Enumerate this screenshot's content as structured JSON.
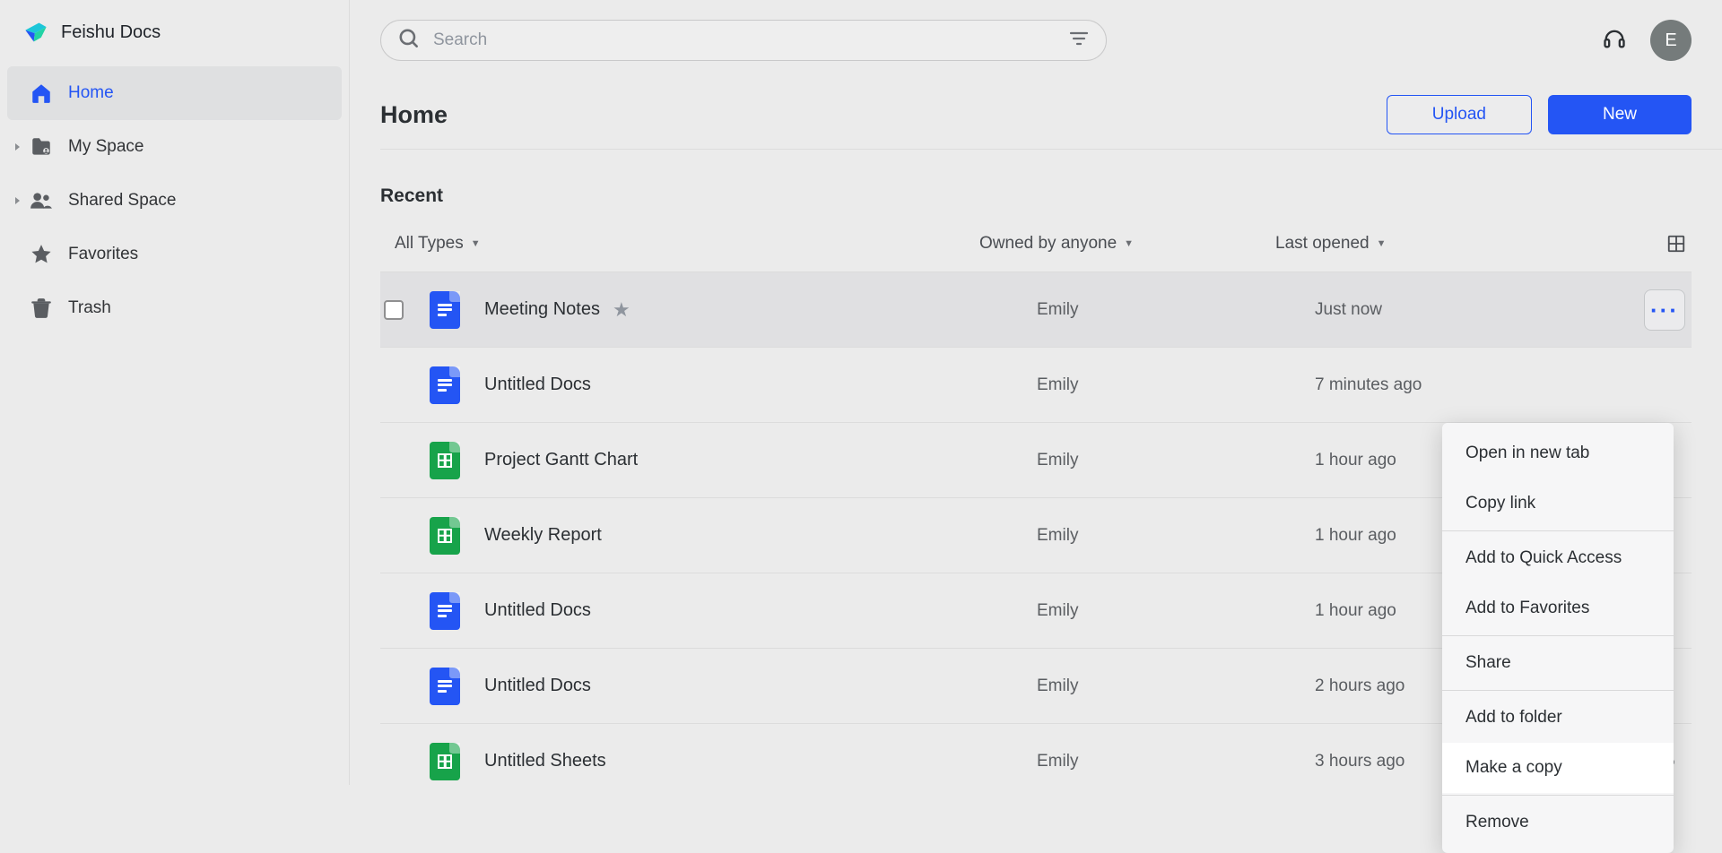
{
  "brand": {
    "name": "Feishu Docs"
  },
  "sidebar": {
    "items": [
      {
        "label": "Home",
        "icon": "home-icon",
        "active": true,
        "expandable": false
      },
      {
        "label": "My Space",
        "icon": "folder-user-icon",
        "active": false,
        "expandable": true
      },
      {
        "label": "Shared Space",
        "icon": "people-icon",
        "active": false,
        "expandable": true
      },
      {
        "label": "Favorites",
        "icon": "star-icon",
        "active": false,
        "expandable": false
      },
      {
        "label": "Trash",
        "icon": "trash-icon",
        "active": false,
        "expandable": false
      }
    ]
  },
  "search": {
    "placeholder": "Search"
  },
  "user": {
    "initial": "E"
  },
  "page": {
    "title": "Home",
    "upload_label": "Upload",
    "new_label": "New",
    "section_title": "Recent"
  },
  "filters": {
    "type": "All Types",
    "owner": "Owned by anyone",
    "sort": "Last opened"
  },
  "files": [
    {
      "name": "Meeting Notes",
      "type": "doc",
      "owner": "Emily",
      "time": "Just now",
      "hovered": true,
      "show_more": true
    },
    {
      "name": "Untitled Docs",
      "type": "doc",
      "owner": "Emily",
      "time": "7 minutes ago"
    },
    {
      "name": "Project Gantt Chart",
      "type": "sheet",
      "owner": "Emily",
      "time": "1 hour ago"
    },
    {
      "name": "Weekly Report",
      "type": "sheet",
      "owner": "Emily",
      "time": "1 hour ago"
    },
    {
      "name": "Untitled Docs",
      "type": "doc",
      "owner": "Emily",
      "time": "1 hour ago"
    },
    {
      "name": "Untitled Docs",
      "type": "doc",
      "owner": "Emily",
      "time": "2 hours ago"
    },
    {
      "name": "Untitled Sheets",
      "type": "sheet",
      "owner": "Emily",
      "time": "3 hours ago",
      "show_more": true,
      "plain_more": true
    }
  ],
  "context_menu": {
    "items": [
      {
        "label": "Open in new tab"
      },
      {
        "label": "Copy link"
      },
      {
        "sep": true
      },
      {
        "label": "Add to Quick Access"
      },
      {
        "label": "Add to Favorites"
      },
      {
        "sep": true
      },
      {
        "label": "Share"
      },
      {
        "sep": true
      },
      {
        "label": "Add to folder"
      },
      {
        "label": "Make a copy",
        "hover": true
      },
      {
        "sep": true
      },
      {
        "label": "Remove"
      }
    ]
  }
}
